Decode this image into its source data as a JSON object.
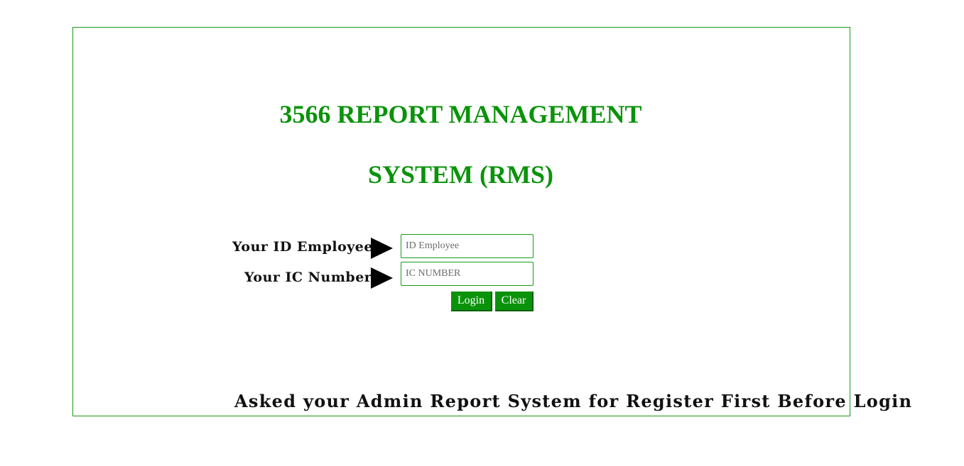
{
  "header": {
    "title_line1": "3566 REPORT MANAGEMENT",
    "title_line2": "SYSTEM (RMS)"
  },
  "login_form": {
    "id_label": "Your ID Employee",
    "id_placeholder": "ID Employee",
    "id_value": "",
    "ic_label": "Your IC Number",
    "ic_placeholder": "IC NUMBER",
    "ic_value": "",
    "login_label": "Login",
    "clear_label": "Clear"
  },
  "footer": {
    "note": "Asked your Admin Report System for Register First Before Login"
  },
  "colors": {
    "accent": "#0a930a",
    "border": "#1a9a1a"
  },
  "icons": {
    "field_pointer": "arrow-right-icon"
  }
}
